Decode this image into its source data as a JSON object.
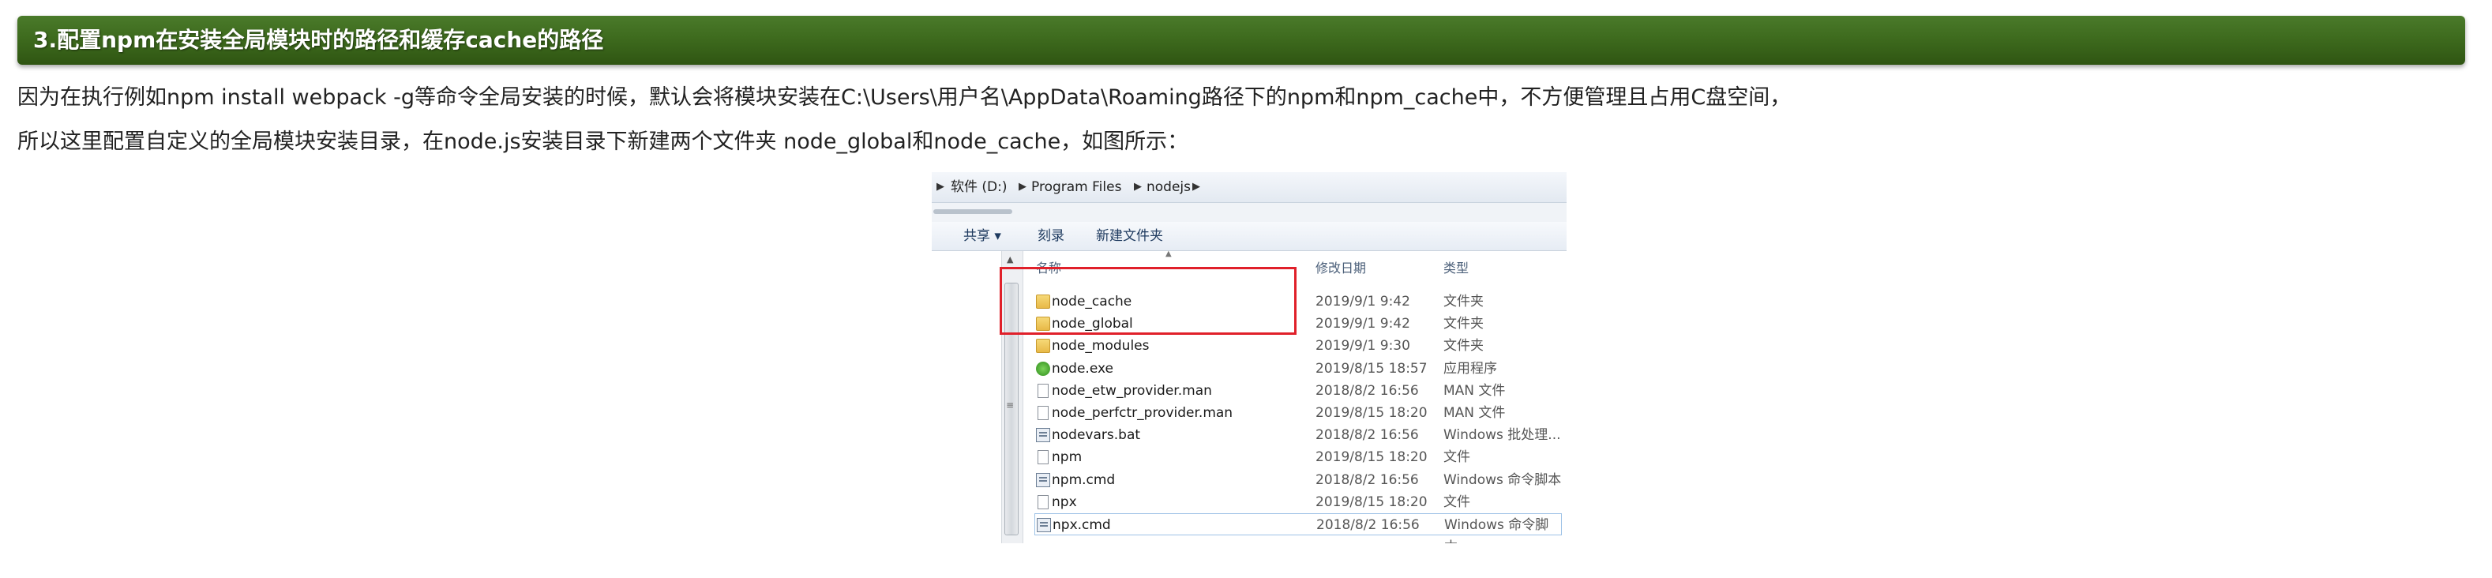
{
  "heading": "3.配置npm在安装全局模块时的路径和缓存cache的路径",
  "paragraphs": [
    "因为在执行例如npm install webpack -g等命令全局安装的时候，默认会将模块安装在C:\\Users\\用户名\\AppData\\Roaming路径下的npm和npm_cache中，不方便管理且占用C盘空间，",
    "所以这里配置自定义的全局模块安装目录，在node.js安装目录下新建两个文件夹 node_global和node_cache，如图所示："
  ],
  "explorer": {
    "breadcrumb": [
      "软件 (D:)",
      "Program Files",
      "nodejs"
    ],
    "toolbar": [
      "共享 ▾",
      "刻录",
      "新建文件夹"
    ],
    "columns": {
      "name": "名称",
      "date": "修改日期",
      "type": "类型"
    },
    "files": [
      {
        "name": "node_cache",
        "date": "2019/9/1 9:42",
        "type": "文件夹",
        "icon": "folder"
      },
      {
        "name": "node_global",
        "date": "2019/9/1 9:42",
        "type": "文件夹",
        "icon": "folder"
      },
      {
        "name": "node_modules",
        "date": "2019/9/1 9:30",
        "type": "文件夹",
        "icon": "folder"
      },
      {
        "name": "node.exe",
        "date": "2019/8/15 18:57",
        "type": "应用程序",
        "icon": "exe"
      },
      {
        "name": "node_etw_provider.man",
        "date": "2018/8/2 16:56",
        "type": "MAN 文件",
        "icon": "file"
      },
      {
        "name": "node_perfctr_provider.man",
        "date": "2019/8/15 18:20",
        "type": "MAN 文件",
        "icon": "file"
      },
      {
        "name": "nodevars.bat",
        "date": "2018/8/2 16:56",
        "type": "Windows 批处理...",
        "icon": "script"
      },
      {
        "name": "npm",
        "date": "2019/8/15 18:20",
        "type": "文件",
        "icon": "file"
      },
      {
        "name": "npm.cmd",
        "date": "2018/8/2 16:56",
        "type": "Windows 命令脚本",
        "icon": "script"
      },
      {
        "name": "npx",
        "date": "2019/8/15 18:20",
        "type": "文件",
        "icon": "file"
      },
      {
        "name": "npx.cmd",
        "date": "2018/8/2 16:56",
        "type": "Windows 命令脚本",
        "icon": "script"
      }
    ],
    "highlight_color": "#e0202a"
  }
}
